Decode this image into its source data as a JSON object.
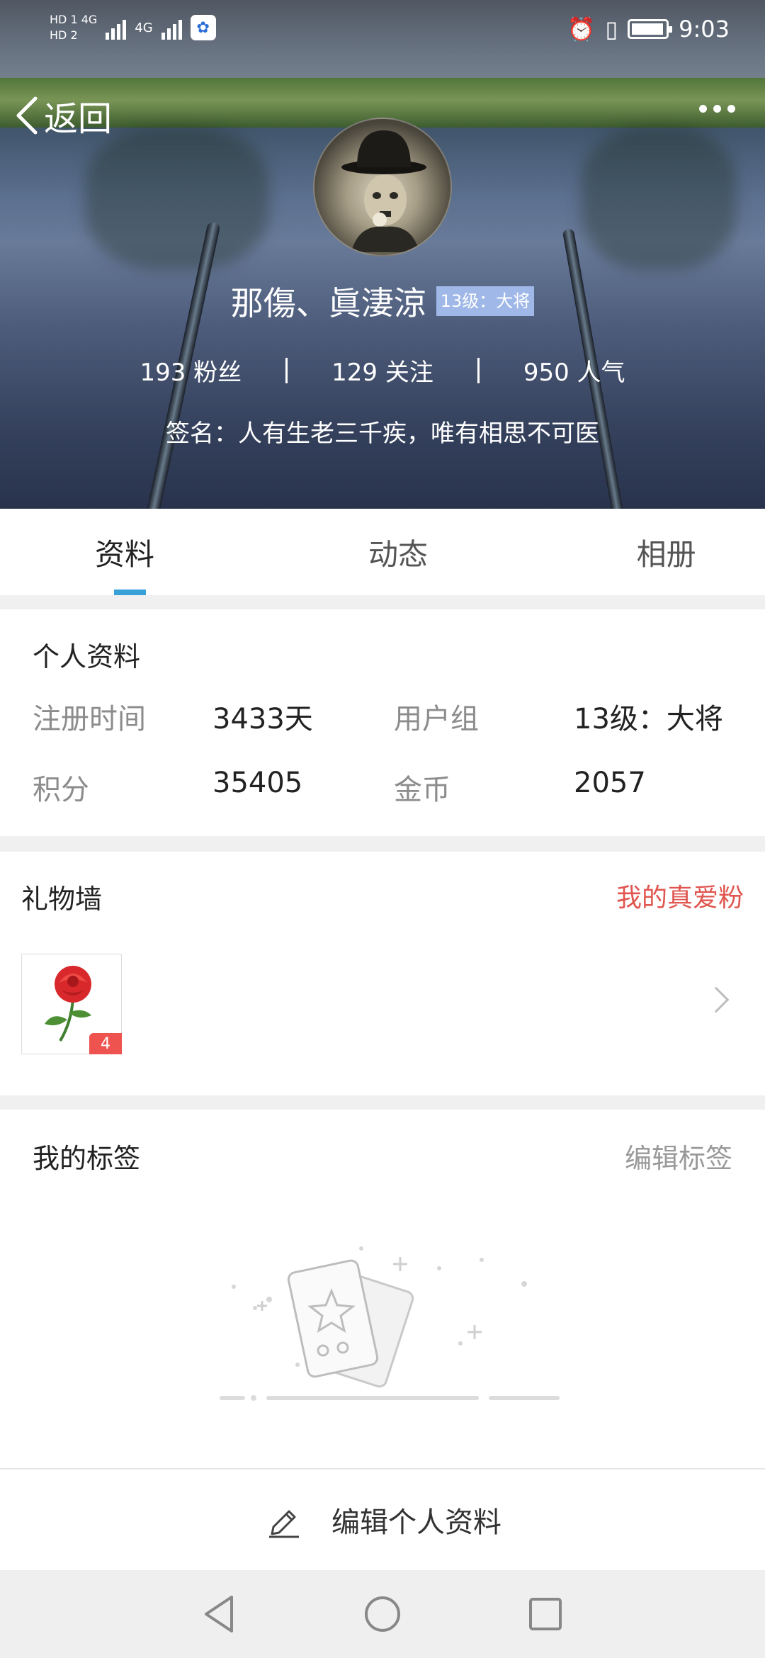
{
  "status_bar": {
    "network_top": "HD 1 4G",
    "network_bottom": "HD 2",
    "network_2": "4G",
    "time": "9:03",
    "app_icon_name": "baidu-paw-icon"
  },
  "header": {
    "back_label": "返回",
    "username": "那傷、眞淒涼",
    "level_badge": "13级：大将",
    "stats": {
      "fans": "193 粉丝",
      "following": "129 关注",
      "popularity": "950 人气"
    },
    "signature": "签名：人有生老三千疾，唯有相思不可医"
  },
  "tabs": [
    {
      "label": "资料",
      "active": true
    },
    {
      "label": "动态",
      "active": false
    },
    {
      "label": "相册",
      "active": false
    }
  ],
  "profile": {
    "title": "个人资料",
    "fields": [
      {
        "key": "注册时间",
        "value": "3433天"
      },
      {
        "key": "用户组",
        "value": "13级：大将"
      },
      {
        "key": "积分",
        "value": "35405"
      },
      {
        "key": "金币",
        "value": "2057"
      }
    ]
  },
  "gift_wall": {
    "title": "礼物墙",
    "link": "我的真爱粉",
    "items": [
      {
        "icon": "rose-icon",
        "count": "4"
      }
    ]
  },
  "tags": {
    "title": "我的标签",
    "link": "编辑标签"
  },
  "edit_bar": {
    "label": "编辑个人资料"
  },
  "colors": {
    "accent_tab": "#3aa0d8",
    "link_red": "#e0554f",
    "badge_blue": "#9fb8e8"
  }
}
